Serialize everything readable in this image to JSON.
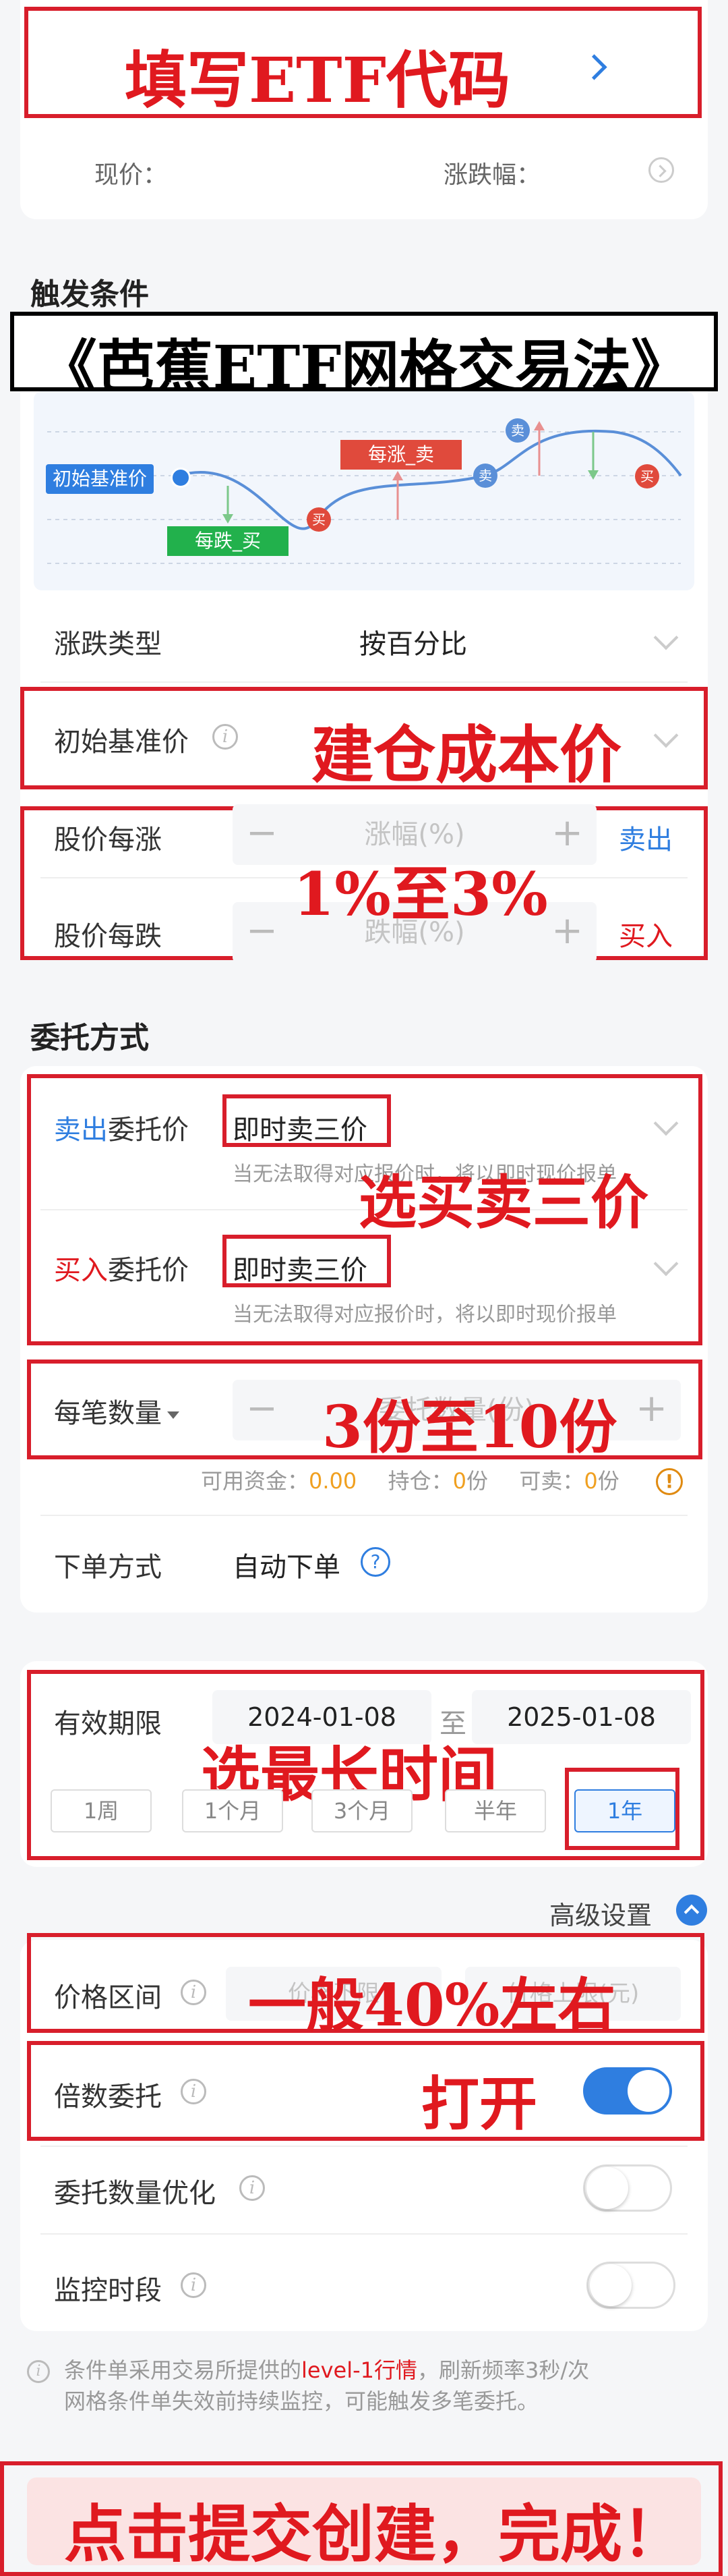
{
  "header": {
    "etf_code_annotation": "填写ETF代码",
    "price_label": "现价：",
    "change_label": "涨跌幅："
  },
  "trigger": {
    "section_title": "触发条件",
    "title_banner": "《芭蕉ETF网格交易法》",
    "diagram": {
      "base_label": "初始基准价",
      "fall_buy_label": "每跌_买",
      "rise_sell_label": "每涨_卖",
      "buy_marker": "买",
      "sell_marker": "卖"
    },
    "change_type_label": "涨跌类型",
    "change_type_value": "按百分比",
    "base_price_label": "初始基准价",
    "base_price_annotation": "建仓成本价",
    "rise_label": "股价每涨",
    "rise_placeholder": "涨幅(%)",
    "rise_action": "卖出",
    "fall_label": "股价每跌",
    "fall_placeholder": "跌幅(%)",
    "fall_action": "买入",
    "range_annotation": "1%至3%"
  },
  "order": {
    "section_title": "委托方式",
    "sell_prefix": "卖出",
    "sell_suffix": "委托价",
    "sell_value": "即时卖三价",
    "sell_hint": "当无法取得对应报价时，将以即时现价报单",
    "buy_prefix": "买入",
    "buy_suffix": "委托价",
    "buy_value": "即时卖三价",
    "buy_hint": "当无法取得对应报价时，将以即时现价报单",
    "price_annotation": "选买卖三价",
    "qty_label": "每笔数量",
    "qty_placeholder": "委托数量(份)",
    "qty_annotation": "3份至10份",
    "funds_label": "可用资金：",
    "funds_value": "0.00",
    "hold_label": "持仓：",
    "hold_value": "0",
    "hold_unit": "份",
    "sellable_label": "可卖：",
    "sellable_value": "0",
    "sellable_unit": "份",
    "mode_label": "下单方式",
    "mode_value": "自动下单"
  },
  "validity": {
    "label": "有效期限",
    "start": "2024-01-08",
    "to": "至",
    "end": "2025-01-08",
    "annotation": "选最长时间",
    "tabs": [
      "1周",
      "1个月",
      "3个月",
      "半年",
      "1年"
    ],
    "active_tab": "1年"
  },
  "advanced": {
    "title": "高级设置",
    "price_range_label": "价格区间",
    "price_min_placeholder": "价格下限",
    "price_max_placeholder": "价格上限(元)",
    "price_range_annotation": "一般40%左右",
    "multiple_label": "倍数委托",
    "multiple_annotation": "打开",
    "multiple_on": true,
    "qty_opt_label": "委托数量优化",
    "qty_opt_on": false,
    "monitor_label": "监控时段",
    "monitor_on": false
  },
  "footer": {
    "note_line1_a": "条件单采用交易所提供的",
    "note_line1_link": "level-1行情",
    "note_line1_b": "，刷新频率3秒/次",
    "note_line2": "网格条件单失效前持续监控，可能触发多笔委托。",
    "submit_annotation": "点击提交创建，完成！"
  },
  "colors": {
    "accent_red": "#e0191f",
    "link_blue": "#2f7ee0",
    "sell_blue": "#2f7ee0",
    "buy_red": "#e0191f",
    "toggle_on": "#2f7ee0",
    "funds_orange": "#f0a020"
  }
}
